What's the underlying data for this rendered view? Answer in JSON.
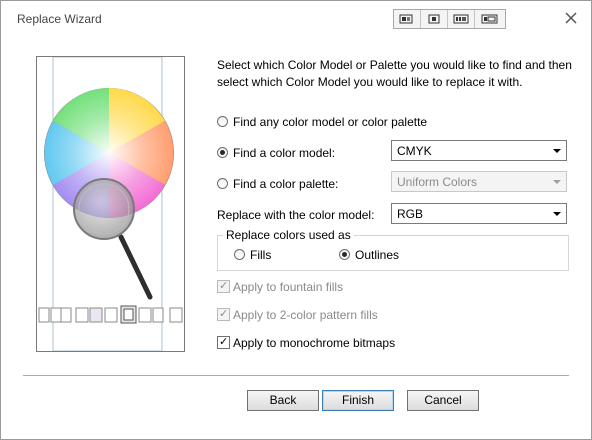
{
  "window": {
    "title": "Replace Wizard"
  },
  "titlebar": {
    "mode_icons": [
      "color-model-icon",
      "object-icon",
      "text-icon",
      "properties-icon"
    ]
  },
  "instructions": "Select which Color Model or Palette you would like to find and then select which Color Model you would like to replace it with.",
  "find": {
    "any_label": "Find any color model or color palette",
    "model_label": "Find a color model:",
    "model_value": "CMYK",
    "palette_label": "Find a color palette:",
    "palette_value": "Uniform Colors",
    "selected": "model"
  },
  "replace": {
    "label": "Replace with the color model:",
    "value": "RGB"
  },
  "used_as": {
    "legend": "Replace colors used as",
    "fills_label": "Fills",
    "outlines_label": "Outlines",
    "selected": "outlines"
  },
  "options": {
    "fountain_label": "Apply to fountain fills",
    "pattern_label": "Apply to 2-color pattern fills",
    "bitmaps_label": "Apply to monochrome bitmaps"
  },
  "buttons": {
    "back": "Back",
    "finish": "Finish",
    "cancel": "Cancel"
  },
  "colors": {
    "accent": "#3c7fb1",
    "disabled_text": "#8a8a8a"
  }
}
